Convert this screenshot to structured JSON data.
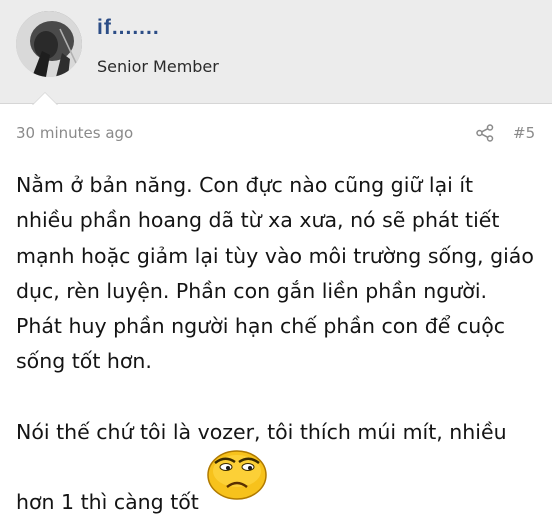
{
  "post": {
    "username": "if.......",
    "user_title": "Senior Member",
    "timestamp": "30 minutes ago",
    "post_number": "#5",
    "paragraphs": [
      "Nằm ở bản năng. Con đực nào cũng giữ lại ít nhiều phần hoang dã từ xa xưa, nó sẽ phát tiết mạnh hoặc giảm lại tùy vào môi trường sống, giáo dục, rèn luyện. Phần con gắn liền phần người. Phát huy phần người hạn chế phần con để cuộc sống tốt hơn.",
      "Nói thế chứ tôi là vozer, tôi thích múi mít, nhiều"
    ],
    "last_line": "hơn 1 thì càng tốt"
  },
  "icons": {
    "share": "share-icon",
    "emoji": "smiley-unamused-icon"
  },
  "colors": {
    "username": "#2c4d86",
    "header_bg": "#ececec",
    "meta": "#8a8a8a",
    "emoji_face": "#f7c21c"
  }
}
